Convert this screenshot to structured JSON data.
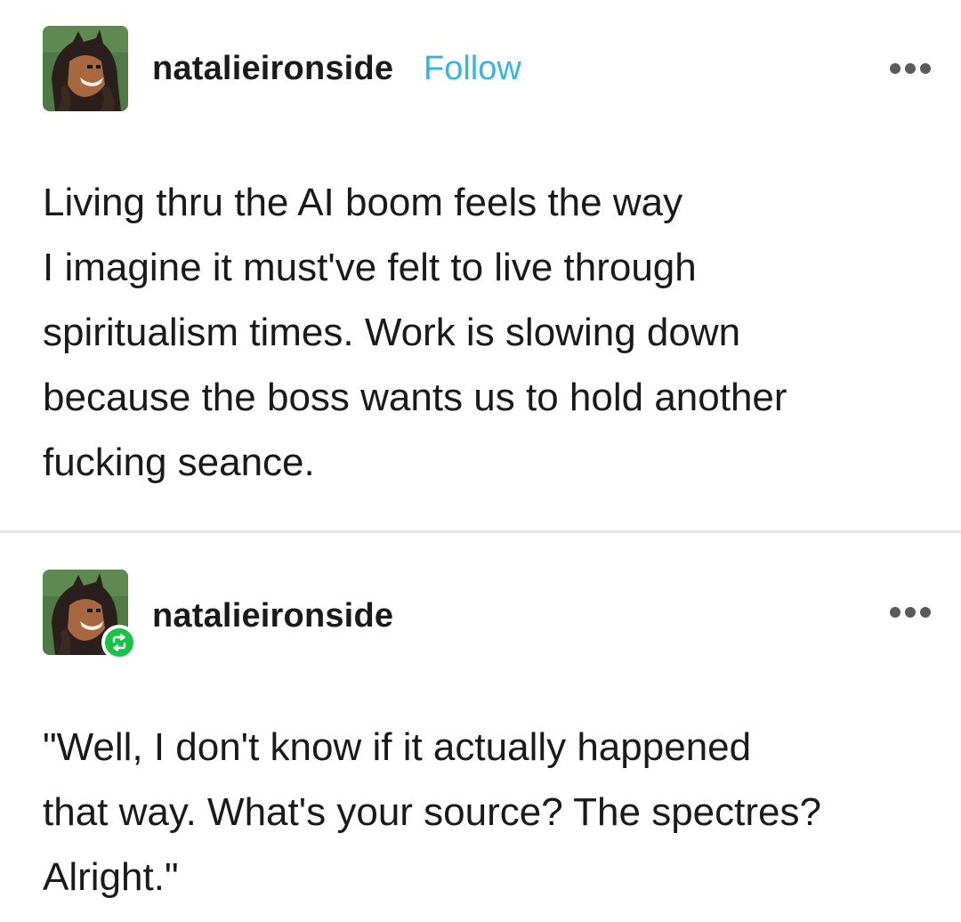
{
  "original_post": {
    "username": "natalieironside",
    "follow_label": "Follow",
    "avatar": "avatar-image",
    "more_icon": "more-options-icon",
    "body": "Living thru the AI boom feels the way\nI imagine it must've felt to live through\nspiritualism times.  Work is slowing down\nbecause the boss wants us to hold another\nfucking seance."
  },
  "reblog_post": {
    "username": "natalieironside",
    "avatar": "avatar-image",
    "badge_icon": "reblog-icon",
    "more_icon": "more-options-icon",
    "body": "\"Well, I don't know if it actually happened\nthat way.  What's your source?  The spectres?\nAlright.\""
  },
  "colors": {
    "follow": "#35b4e6",
    "reblog_badge": "#18c447",
    "text": "#1a1a1a",
    "divider": "#e8e8e8"
  }
}
